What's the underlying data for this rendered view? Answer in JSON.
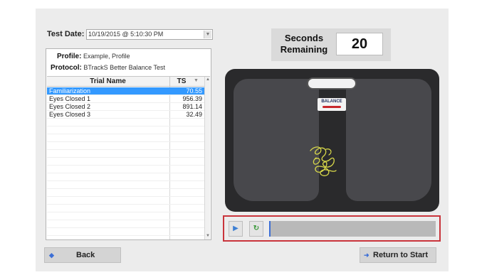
{
  "test_date": {
    "label": "Test Date:",
    "value": "10/19/2015 @ 5:10:30 PM"
  },
  "profile": {
    "label": "Profile:",
    "value": "Example, Profile"
  },
  "protocol": {
    "label": "Protocol:",
    "value": "BTrackS Better Balance Test"
  },
  "table": {
    "headers": {
      "name": "Trial Name",
      "ts": "TS"
    },
    "rows": [
      {
        "name": "Familiarization",
        "ts": "70.55",
        "selected": true
      },
      {
        "name": "Eyes Closed 1",
        "ts": "956.39",
        "selected": false
      },
      {
        "name": "Eyes Closed 2",
        "ts": "891.14",
        "selected": false
      },
      {
        "name": "Eyes Closed 3",
        "ts": "32.49",
        "selected": false
      }
    ]
  },
  "timer": {
    "label_line1": "Seconds",
    "label_line2": "Remaining",
    "value": "20"
  },
  "board": {
    "logo_text": "BALANCE"
  },
  "playback": {
    "progress": 0.01
  },
  "buttons": {
    "back": "Back",
    "return_to_start": "Return to Start"
  },
  "colors": {
    "accent": "#3399ff",
    "highlight_border": "#c9343b",
    "trace": "#d8d84a"
  },
  "icons": {
    "back": "arrow-left-icon",
    "return": "arrow-right-icon",
    "play": "play-icon",
    "reset": "refresh-icon",
    "dropdown": "chevron-down-icon"
  }
}
